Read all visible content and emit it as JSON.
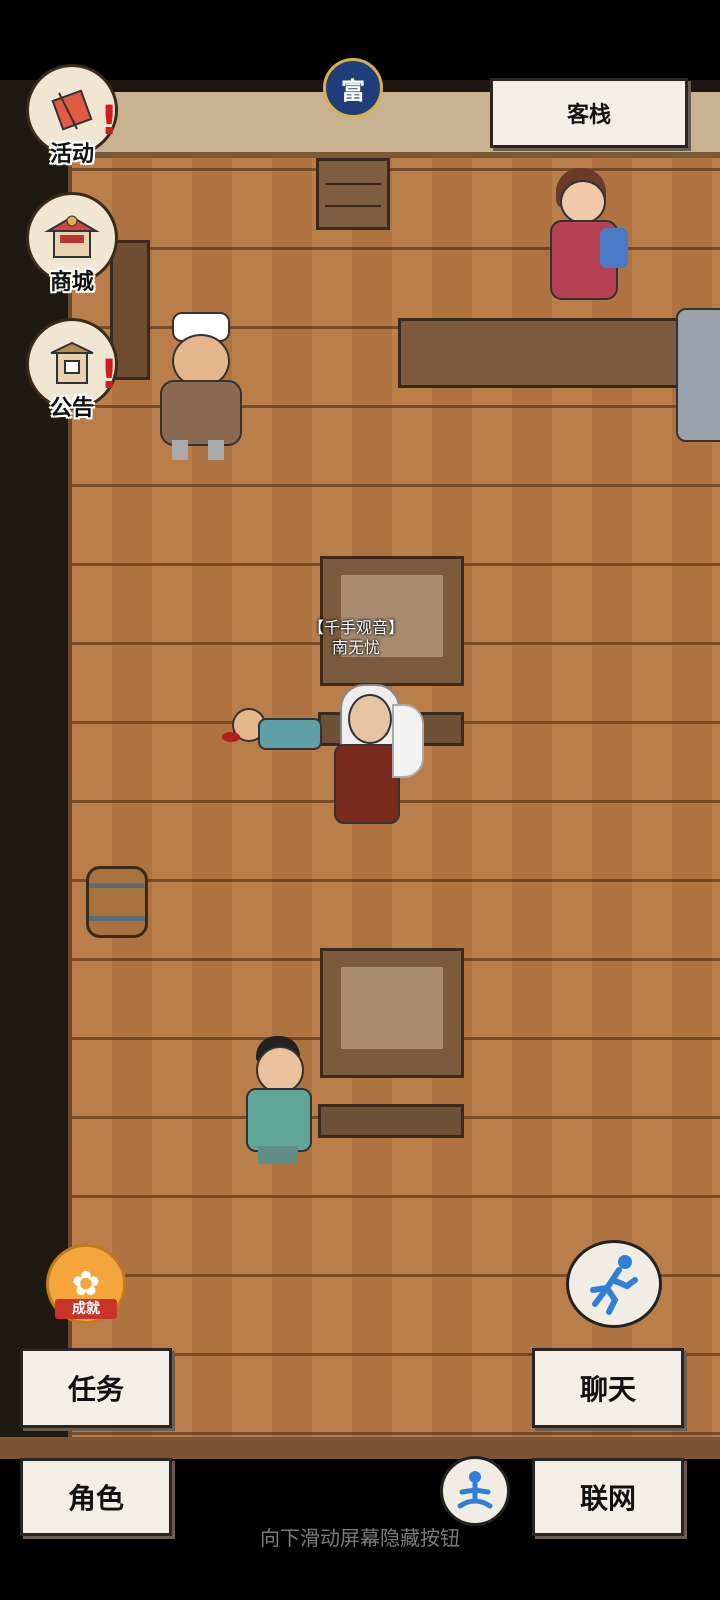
{
  "side_menu": {
    "activity": {
      "label": "活动",
      "icon": "banner-icon"
    },
    "shop": {
      "label": "商城",
      "icon": "shop-icon"
    },
    "notice": {
      "label": "公告",
      "icon": "notice-icon"
    }
  },
  "location": {
    "name": "客栈"
  },
  "player": {
    "title": "【千手观音】",
    "name": "南无忧"
  },
  "buttons": {
    "quest": "任务",
    "character": "角色",
    "chat": "聊天",
    "network": "联网"
  },
  "achievement": {
    "label": "成就"
  },
  "coin_badge": {
    "char": "富"
  },
  "footer_hint": "向下滑动屏幕隐藏按钮",
  "colors": {
    "floor": "#b57843",
    "notification": "#d21b1b",
    "run_icon": "#2f7fd6"
  }
}
